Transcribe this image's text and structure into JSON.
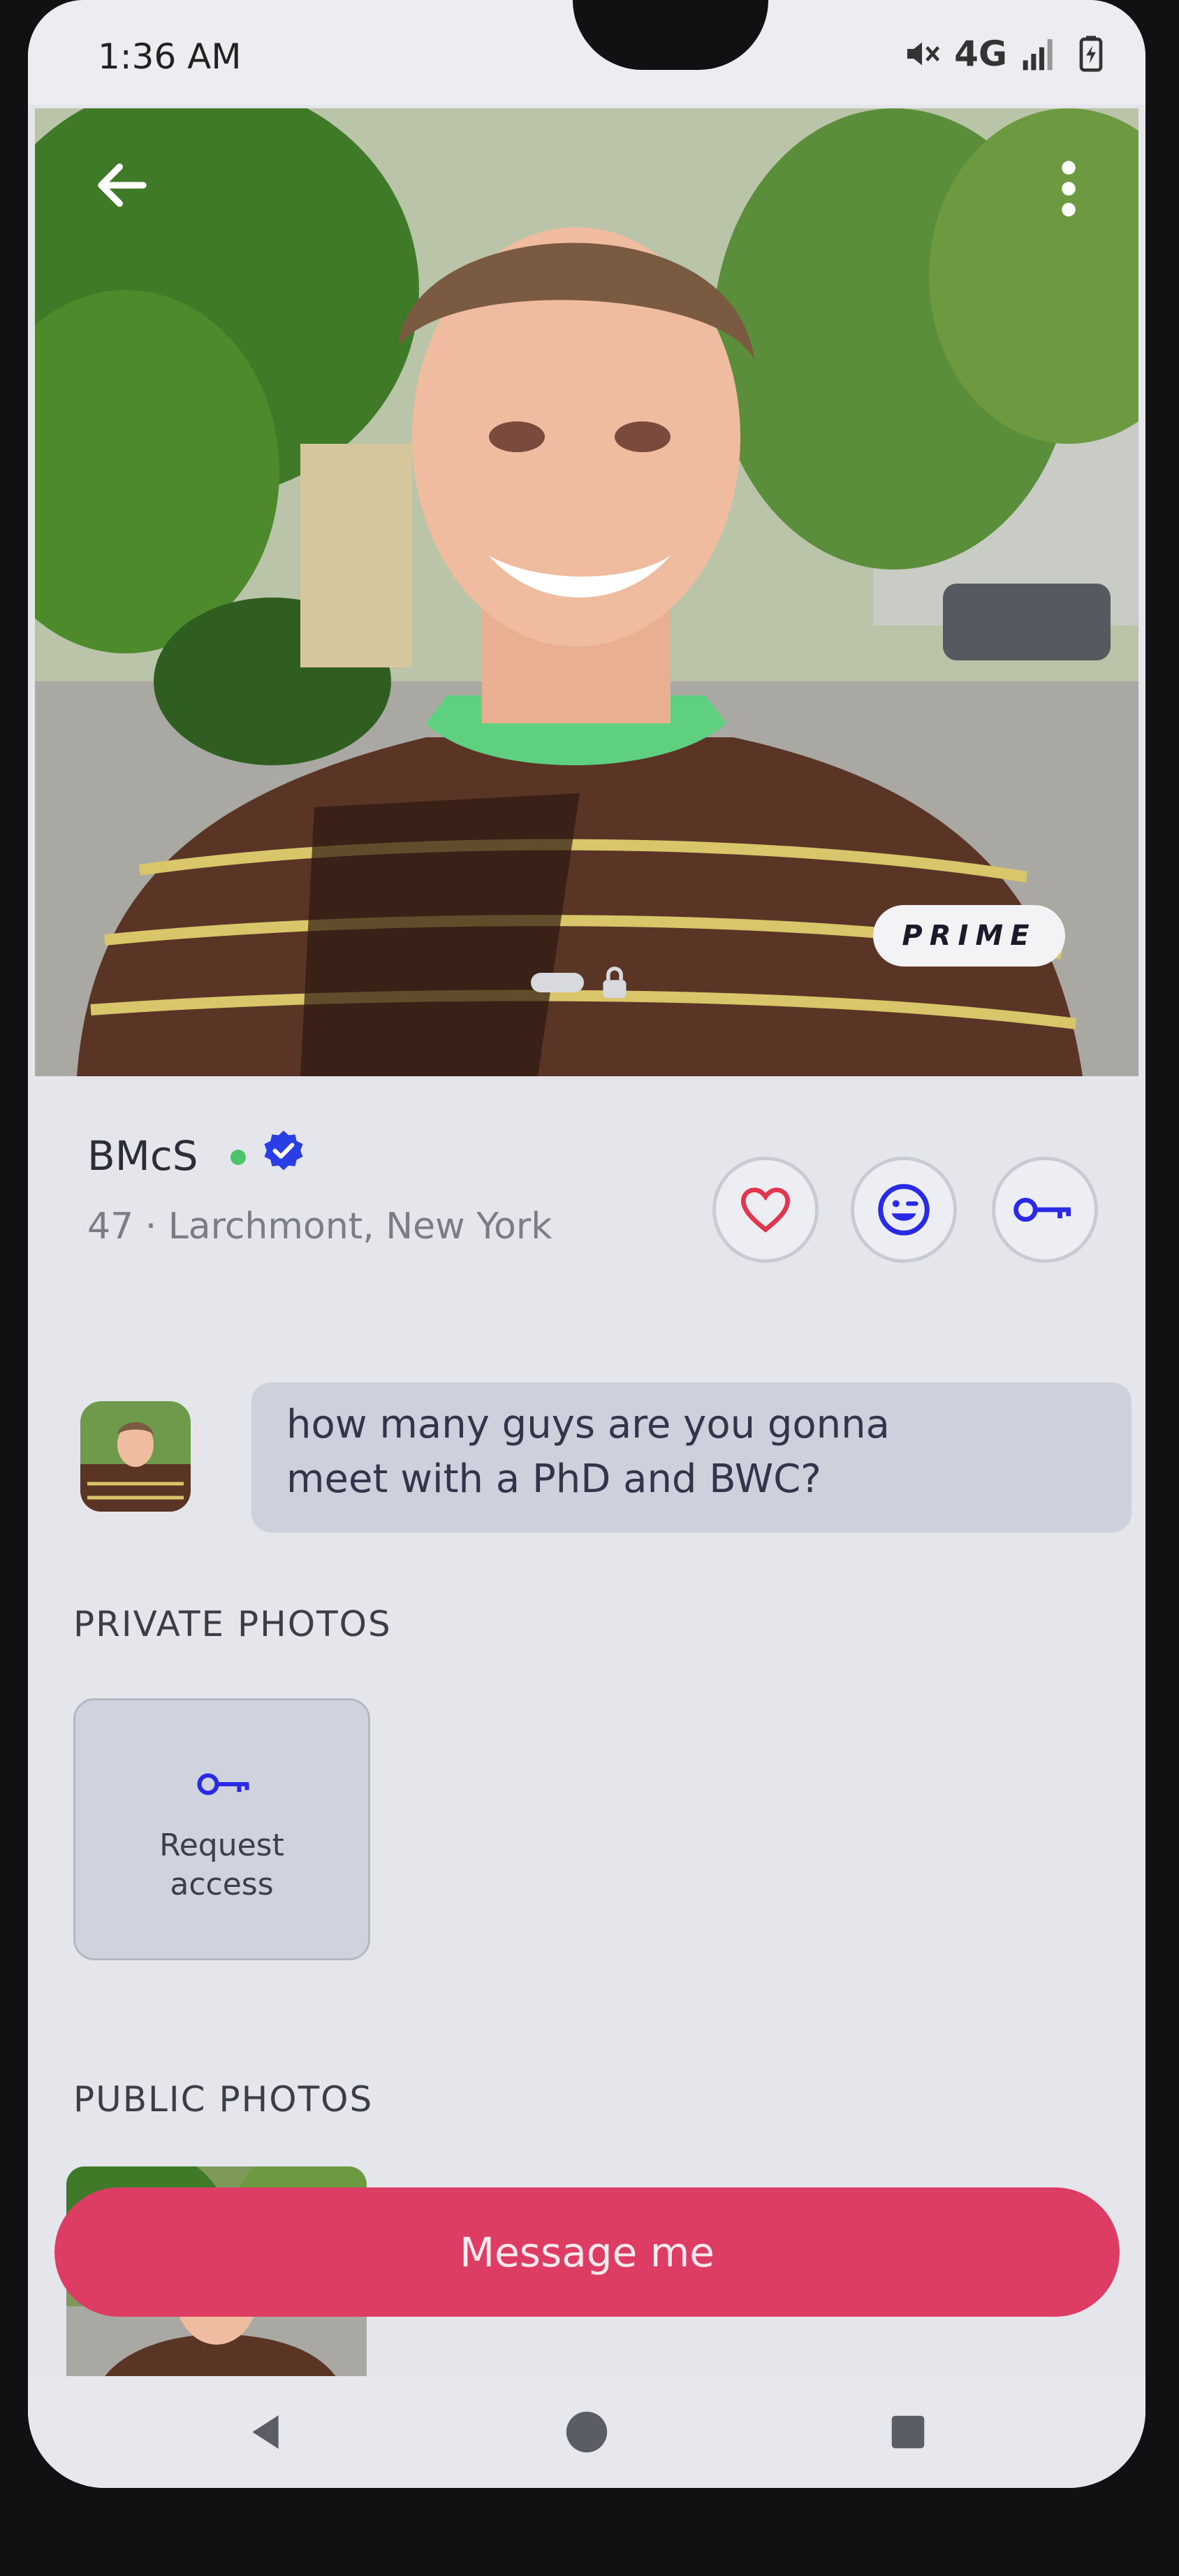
{
  "status_bar": {
    "time": "1:36 AM",
    "network": "4G"
  },
  "hero": {
    "badge": "PRIME",
    "photo_subject": "photo of smiling man in striped sweater outdoors"
  },
  "profile": {
    "name": "BMcS",
    "meta": "47 · Larchmont, New York",
    "online": true,
    "verified": true
  },
  "actions": {
    "like_icon": "heart-icon",
    "wink_icon": "wink-icon",
    "key_icon": "key-icon"
  },
  "message": {
    "line1": "how many guys are you gonna",
    "line2": "meet with a PhD and BWC?"
  },
  "private_photos": {
    "title": "PRIVATE PHOTOS",
    "request_line1": "Request",
    "request_line2": "access"
  },
  "public_photos": {
    "title": "PUBLIC PHOTOS"
  },
  "cta": {
    "label": "Message me"
  },
  "colors": {
    "accent": "#de3d63",
    "icon_blue": "#2a2ae6",
    "heart_red": "#e2364f"
  }
}
